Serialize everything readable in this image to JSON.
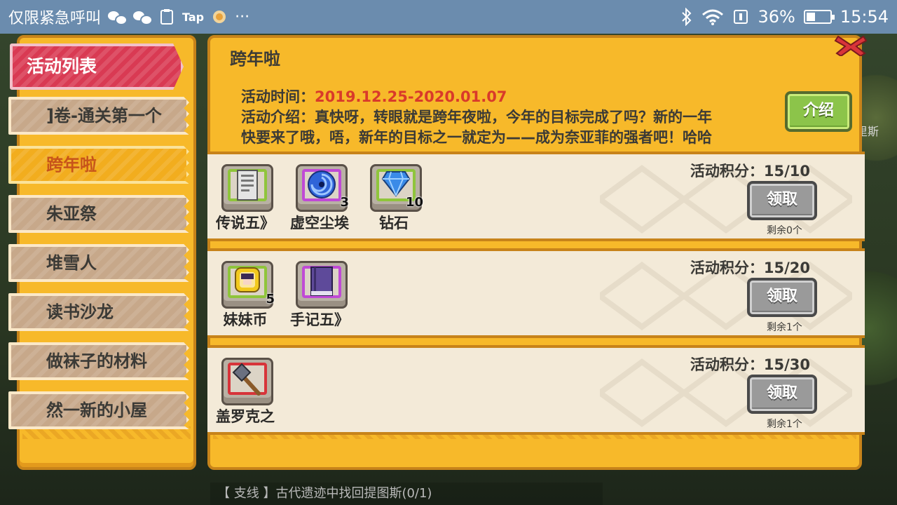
{
  "status_bar": {
    "carrier_text": "仅限紧急呼叫",
    "tap_label": "Tap",
    "more": "···",
    "battery": "36%",
    "battery_level": 0.36,
    "time": "15:54"
  },
  "sidebar": {
    "header": "活动列表",
    "items": [
      {
        "label": "]卷-通关第一个",
        "active": false
      },
      {
        "label": "跨年啦",
        "active": true
      },
      {
        "label": "朱亚祭",
        "active": false
      },
      {
        "label": "堆雪人",
        "active": false
      },
      {
        "label": "读书沙龙",
        "active": false
      },
      {
        "label": "做袜子的材料",
        "active": false
      },
      {
        "label": "然一新的小屋",
        "active": false
      }
    ]
  },
  "event": {
    "title": "跨年啦",
    "time_label": "活动时间：",
    "time_value": "2019.12.25-2020.01.07",
    "intro_label": "活动介绍：",
    "intro_line1": "真快呀，转眼就是跨年夜啦，今年的目标完成了吗？新的一年",
    "intro_line2": "快要来了哦，唔，新年的目标之一就定为——成为奈亚菲的强者吧！哈哈",
    "intro_button": "介绍"
  },
  "rewards": [
    {
      "score": "活动积分：15/10",
      "button": "领取",
      "remaining": "剩余0个",
      "items": [
        {
          "name": "传说五》",
          "count": "",
          "frame": "green",
          "icon": "scroll-icon"
        },
        {
          "name": "虚空尘埃",
          "count": "3",
          "frame": "purple",
          "icon": "void-dust-icon"
        },
        {
          "name": "钻石",
          "count": "10",
          "frame": "green",
          "icon": "diamond-icon"
        }
      ]
    },
    {
      "score": "活动积分：15/20",
      "button": "领取",
      "remaining": "剩余1个",
      "items": [
        {
          "name": "妹妹币",
          "count": "5",
          "frame": "green",
          "icon": "sister-coin-icon"
        },
        {
          "name": "手记五》",
          "count": "",
          "frame": "purple",
          "icon": "book-icon"
        }
      ]
    },
    {
      "score": "活动积分：15/30",
      "button": "领取",
      "remaining": "剩余1个",
      "items": [
        {
          "name": "盖罗克之",
          "count": "",
          "frame": "red",
          "icon": "hammer-icon"
        }
      ]
    }
  ],
  "background": {
    "quest_text": "【 支线 】古代遗迹中找回提图斯(0/1)",
    "side_tag": "里斯"
  }
}
